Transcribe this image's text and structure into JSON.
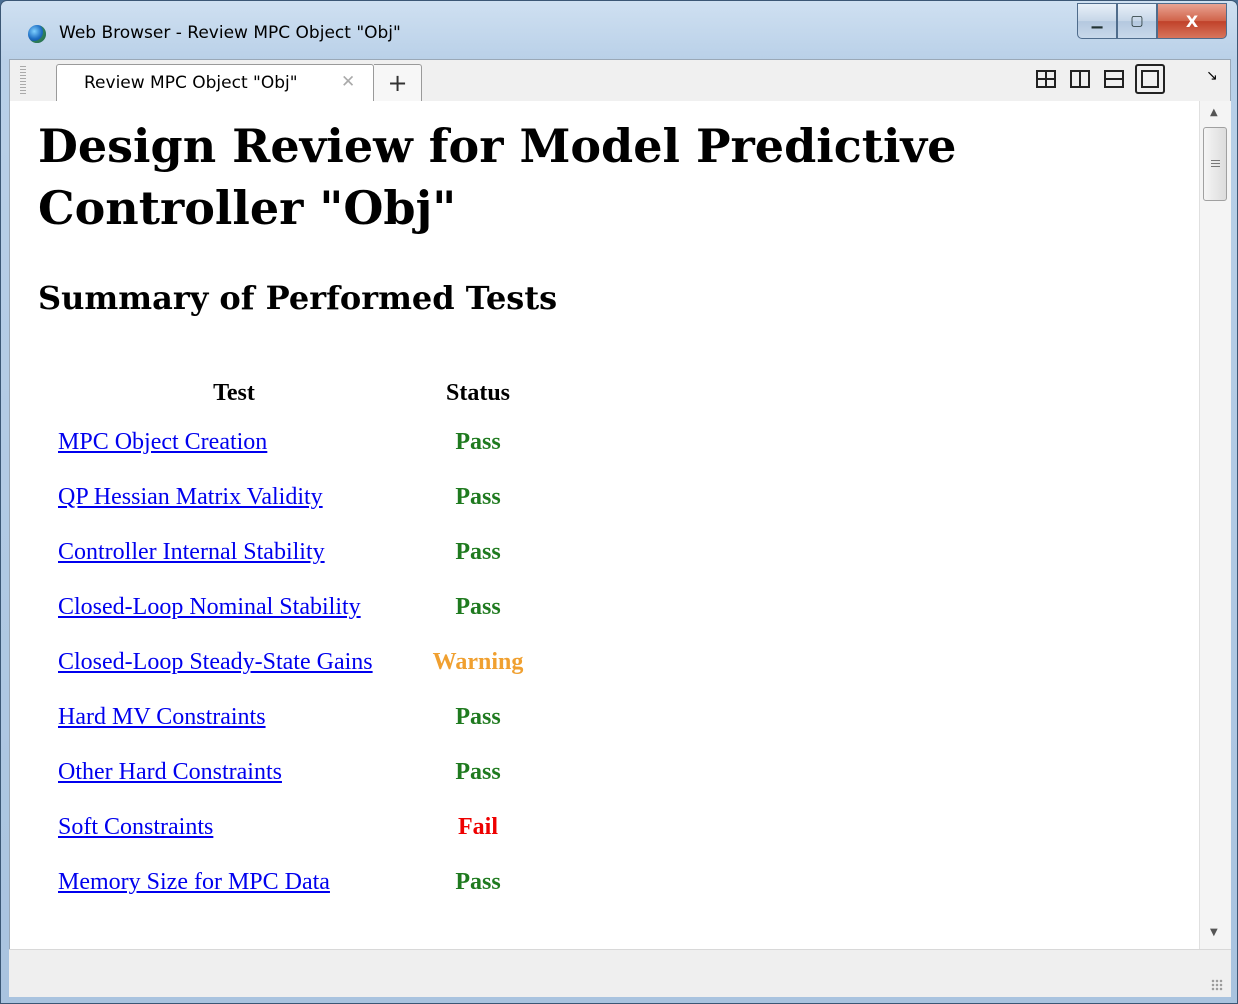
{
  "window": {
    "title": "Web Browser - Review MPC Object \"Obj\"",
    "controls": {
      "minimize": "▁",
      "maximize": "▢",
      "close": "X"
    }
  },
  "tabs": {
    "active_label": "Review MPC Object \"Obj\"",
    "close_glyph": "✕",
    "add_glyph": "+"
  },
  "toolbar": {
    "layout_buttons": [
      "grid-2x2-icon",
      "split-vertical-icon",
      "split-horizontal-icon",
      "single-pane-icon"
    ],
    "menu_glyph": "↘"
  },
  "page": {
    "title": "Design Review for Model Predictive Controller \"Obj\"",
    "subtitle": "Summary of Performed Tests",
    "table": {
      "headers": [
        "Test",
        "Status"
      ],
      "rows": [
        {
          "test": "MPC Object Creation",
          "status": "Pass"
        },
        {
          "test": "QP Hessian Matrix Validity",
          "status": "Pass"
        },
        {
          "test": "Controller Internal Stability",
          "status": "Pass"
        },
        {
          "test": "Closed-Loop Nominal Stability",
          "status": "Pass"
        },
        {
          "test": "Closed-Loop Steady-State Gains",
          "status": "Warning"
        },
        {
          "test": "Hard MV Constraints",
          "status": "Pass"
        },
        {
          "test": "Other Hard Constraints",
          "status": "Pass"
        },
        {
          "test": "Soft Constraints",
          "status": "Fail"
        },
        {
          "test": "Memory Size for MPC Data",
          "status": "Pass"
        }
      ]
    }
  },
  "colors": {
    "pass": "#1f7a1f",
    "warning": "#f0a030",
    "fail": "#ee0000",
    "link": "#0000ee"
  }
}
